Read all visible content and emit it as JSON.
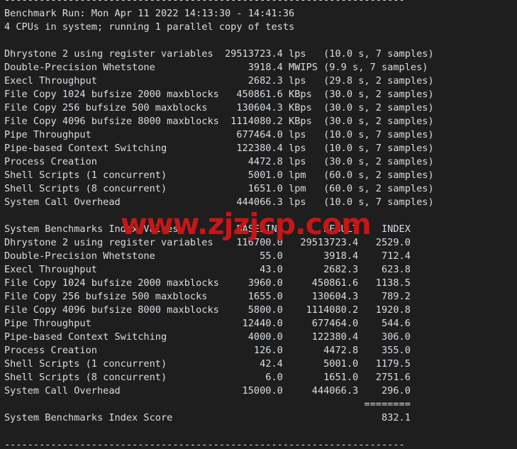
{
  "terminal": {
    "background_color": "#1e1e1e",
    "text_color": "#d8dee4",
    "rule_top": "---------------------------------------------------------------------",
    "rule_bottom": "---------------------------------------------------------------------",
    "header_run": "Benchmark Run: Mon Apr 11 2022 14:13:30 - 14:41:36",
    "header_cpus": "4 CPUs in system; running 1 parallel copy of tests",
    "results_title": "",
    "index_header": "System Benchmarks Index Values",
    "index_col_baseline": "BASELINE",
    "index_col_result": "RESULT",
    "index_col_index": "INDEX",
    "score_separator": "========",
    "score_label": "System Benchmarks Index Score",
    "score_value": "832.1"
  },
  "watermark": {
    "text": "www.zjzjcp.com",
    "color": "#c61616"
  },
  "raw_results": [
    {
      "name": "Dhrystone 2 using register variables",
      "value": "29513723.4",
      "unit": "lps",
      "timing": "(10.0 s, 7 samples)"
    },
    {
      "name": "Double-Precision Whetstone",
      "value": "3918.4",
      "unit": "MWIPS",
      "timing": "(9.9 s, 7 samples)"
    },
    {
      "name": "Execl Throughput",
      "value": "2682.3",
      "unit": "lps",
      "timing": "(29.8 s, 2 samples)"
    },
    {
      "name": "File Copy 1024 bufsize 2000 maxblocks",
      "value": "450861.6",
      "unit": "KBps",
      "timing": "(30.0 s, 2 samples)"
    },
    {
      "name": "File Copy 256 bufsize 500 maxblocks",
      "value": "130604.3",
      "unit": "KBps",
      "timing": "(30.0 s, 2 samples)"
    },
    {
      "name": "File Copy 4096 bufsize 8000 maxblocks",
      "value": "1114080.2",
      "unit": "KBps",
      "timing": "(30.0 s, 2 samples)"
    },
    {
      "name": "Pipe Throughput",
      "value": "677464.0",
      "unit": "lps",
      "timing": "(10.0 s, 7 samples)"
    },
    {
      "name": "Pipe-based Context Switching",
      "value": "122380.4",
      "unit": "lps",
      "timing": "(10.0 s, 7 samples)"
    },
    {
      "name": "Process Creation",
      "value": "4472.8",
      "unit": "lps",
      "timing": "(30.0 s, 2 samples)"
    },
    {
      "name": "Shell Scripts (1 concurrent)",
      "value": "5001.0",
      "unit": "lpm",
      "timing": "(60.0 s, 2 samples)"
    },
    {
      "name": "Shell Scripts (8 concurrent)",
      "value": "1651.0",
      "unit": "lpm",
      "timing": "(60.0 s, 2 samples)"
    },
    {
      "name": "System Call Overhead",
      "value": "444066.3",
      "unit": "lps",
      "timing": "(10.0 s, 7 samples)"
    }
  ],
  "index_rows": [
    {
      "name": "Dhrystone 2 using register variables",
      "baseline": "116700.0",
      "result": "29513723.4",
      "index": "2529.0"
    },
    {
      "name": "Double-Precision Whetstone",
      "baseline": "55.0",
      "result": "3918.4",
      "index": "712.4"
    },
    {
      "name": "Execl Throughput",
      "baseline": "43.0",
      "result": "2682.3",
      "index": "623.8"
    },
    {
      "name": "File Copy 1024 bufsize 2000 maxblocks",
      "baseline": "3960.0",
      "result": "450861.6",
      "index": "1138.5"
    },
    {
      "name": "File Copy 256 bufsize 500 maxblocks",
      "baseline": "1655.0",
      "result": "130604.3",
      "index": "789.2"
    },
    {
      "name": "File Copy 4096 bufsize 8000 maxblocks",
      "baseline": "5800.0",
      "result": "1114080.2",
      "index": "1920.8"
    },
    {
      "name": "Pipe Throughput",
      "baseline": "12440.0",
      "result": "677464.0",
      "index": "544.6"
    },
    {
      "name": "Pipe-based Context Switching",
      "baseline": "4000.0",
      "result": "122380.4",
      "index": "306.0"
    },
    {
      "name": "Process Creation",
      "baseline": "126.0",
      "result": "4472.8",
      "index": "355.0"
    },
    {
      "name": "Shell Scripts (1 concurrent)",
      "baseline": "42.4",
      "result": "5001.0",
      "index": "1179.5"
    },
    {
      "name": "Shell Scripts (8 concurrent)",
      "baseline": "6.0",
      "result": "1651.0",
      "index": "2751.6"
    },
    {
      "name": "System Call Overhead",
      "baseline": "15000.0",
      "result": "444066.3",
      "index": "296.0"
    }
  ]
}
